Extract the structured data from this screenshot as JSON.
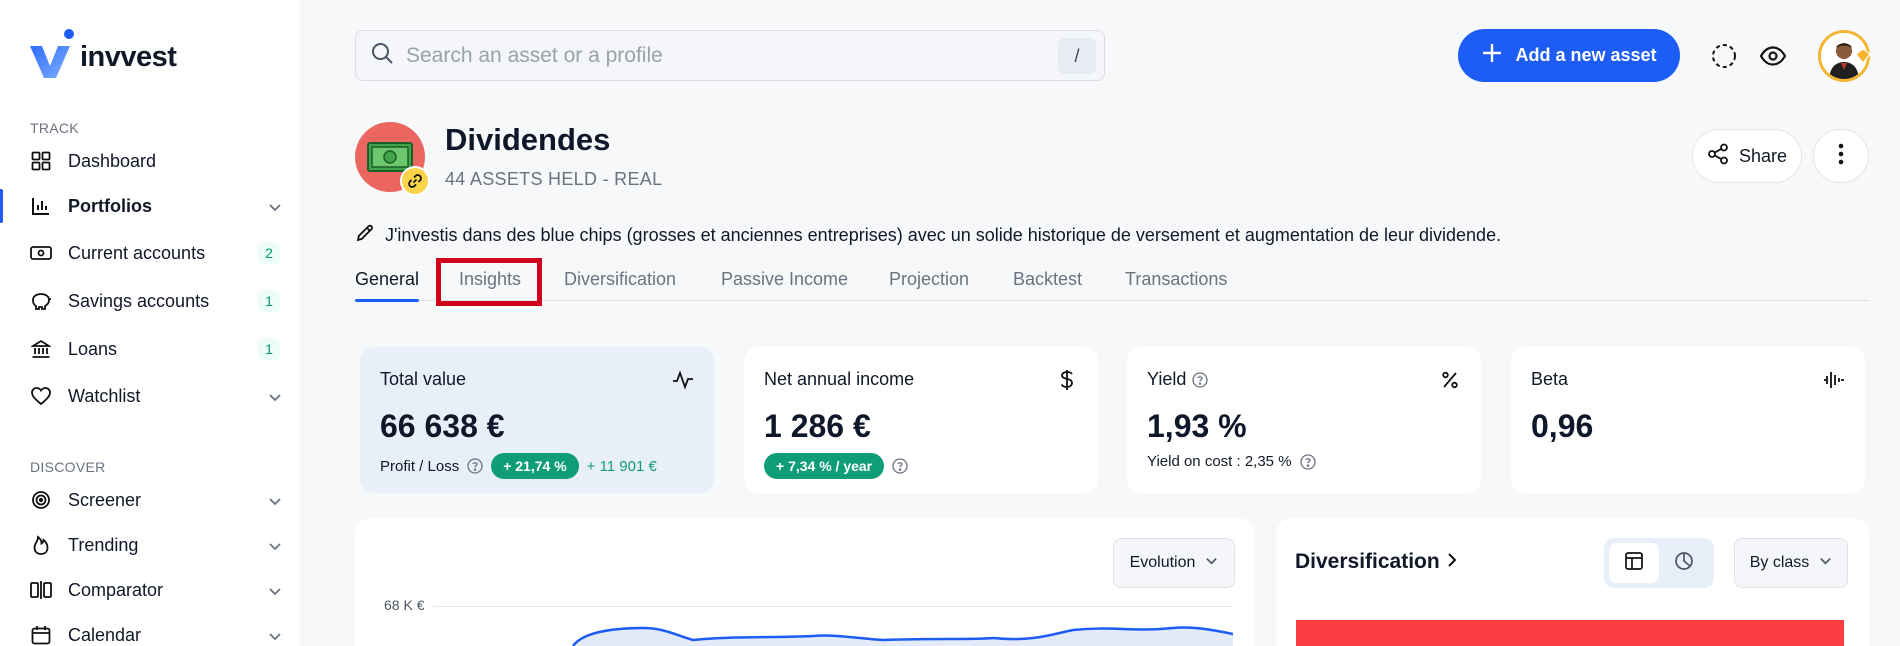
{
  "app": {
    "name": "invvest"
  },
  "sidebar": {
    "track_label": "TRACK",
    "discover_label": "DISCOVER",
    "track_items": [
      {
        "label": "Dashboard",
        "icon": "grid-icon"
      },
      {
        "label": "Portfolios",
        "icon": "bar-chart-icon",
        "active": true,
        "expandable": true
      },
      {
        "label": "Current accounts",
        "icon": "wallet-icon",
        "count": "2"
      },
      {
        "label": "Savings accounts",
        "icon": "piggy-bank-icon",
        "count": "1"
      },
      {
        "label": "Loans",
        "icon": "bank-icon",
        "count": "1"
      },
      {
        "label": "Watchlist",
        "icon": "heart-icon",
        "expandable": true
      }
    ],
    "discover_items": [
      {
        "label": "Screener",
        "icon": "target-icon",
        "expandable": true
      },
      {
        "label": "Trending",
        "icon": "flame-icon",
        "expandable": true
      },
      {
        "label": "Comparator",
        "icon": "compare-icon",
        "expandable": true
      },
      {
        "label": "Calendar",
        "icon": "calendar-icon",
        "expandable": true
      }
    ]
  },
  "header": {
    "search_placeholder": "Search an asset or a profile",
    "search_shortcut": "/",
    "add_asset_label": "Add a new asset"
  },
  "portfolio": {
    "title": "Dividendes",
    "subtitle": "44 ASSETS HELD - REAL",
    "description": "J'investis dans des blue chips (grosses et anciennes entreprises) avec un solide historique de versement et augmentation de leur dividende.",
    "share_label": "Share"
  },
  "tabs": [
    {
      "label": "General",
      "active": true
    },
    {
      "label": "Insights"
    },
    {
      "label": "Diversification"
    },
    {
      "label": "Passive Income"
    },
    {
      "label": "Projection"
    },
    {
      "label": "Backtest"
    },
    {
      "label": "Transactions"
    }
  ],
  "kpis": {
    "total_value": {
      "label": "Total value",
      "value": "66 638 €",
      "pl_label": "Profit / Loss",
      "pl_pct": "+ 21,74 %",
      "pl_abs": "+ 11 901 €"
    },
    "net_income": {
      "label": "Net annual income",
      "value": "1 286 €",
      "growth": "+ 7,34 % / year"
    },
    "yield": {
      "label": "Yield",
      "value": "1,93 %",
      "yoc": "Yield on cost : 2,35 %"
    },
    "beta": {
      "label": "Beta",
      "value": "0,96"
    }
  },
  "evolution_panel": {
    "dropdown_label": "Evolution",
    "y_axis_top_label": "68 K €"
  },
  "diversification_panel": {
    "title": "Diversification",
    "dropdown_label": "By class"
  },
  "colors": {
    "accent": "#1d5cf5",
    "positive": "#0f9d77",
    "highlight": "#d0021b",
    "portfolio_icon_bg": "#ec6660",
    "diversification_bar": "#fb3d44"
  }
}
